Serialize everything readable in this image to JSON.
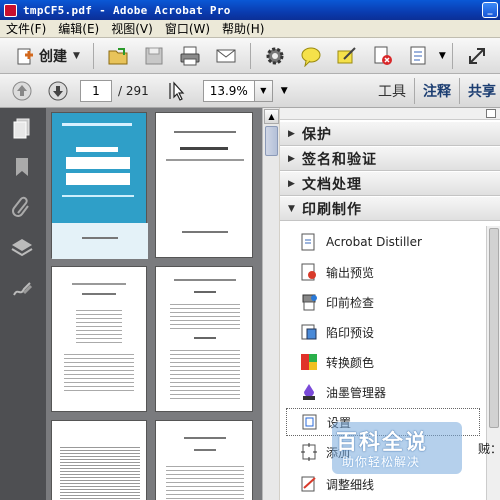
{
  "window": {
    "title": "tmpCF5.pdf - Adobe Acrobat Pro"
  },
  "menu": [
    "文件(F)",
    "编辑(E)",
    "视图(V)",
    "窗口(W)",
    "帮助(H)"
  ],
  "toolbar": {
    "create_label": "创建",
    "page_current": "1",
    "page_total": "/ 291",
    "zoom": "13.9%",
    "tabs": [
      "工具",
      "注释",
      "共享"
    ]
  },
  "sections": [
    {
      "label": "保护",
      "state": "collapsed"
    },
    {
      "label": "签名和验证",
      "state": "collapsed"
    },
    {
      "label": "文档处理",
      "state": "collapsed"
    },
    {
      "label": "印刷制作",
      "state": "expanded"
    }
  ],
  "print_tools": [
    {
      "label": "Acrobat Distiller",
      "icon": "distiller-icon"
    },
    {
      "label": "输出预览",
      "icon": "output-preview-icon"
    },
    {
      "label": "印前检查",
      "icon": "preflight-icon"
    },
    {
      "label": "陷印预设",
      "icon": "trap-presets-icon"
    },
    {
      "label": "转换颜色",
      "icon": "convert-colors-icon"
    },
    {
      "label": "油墨管理器",
      "icon": "ink-manager-icon"
    },
    {
      "label": "设置",
      "icon": "set-page-boxes-icon"
    },
    {
      "label": "添加",
      "icon": "add-marks-icon"
    },
    {
      "label": "调整细线",
      "icon": "fix-hairlines-icon"
    }
  ],
  "watermark": {
    "title": "百科全说",
    "subtitle": "助你轻松解决"
  },
  "peek_text": "贼：清"
}
